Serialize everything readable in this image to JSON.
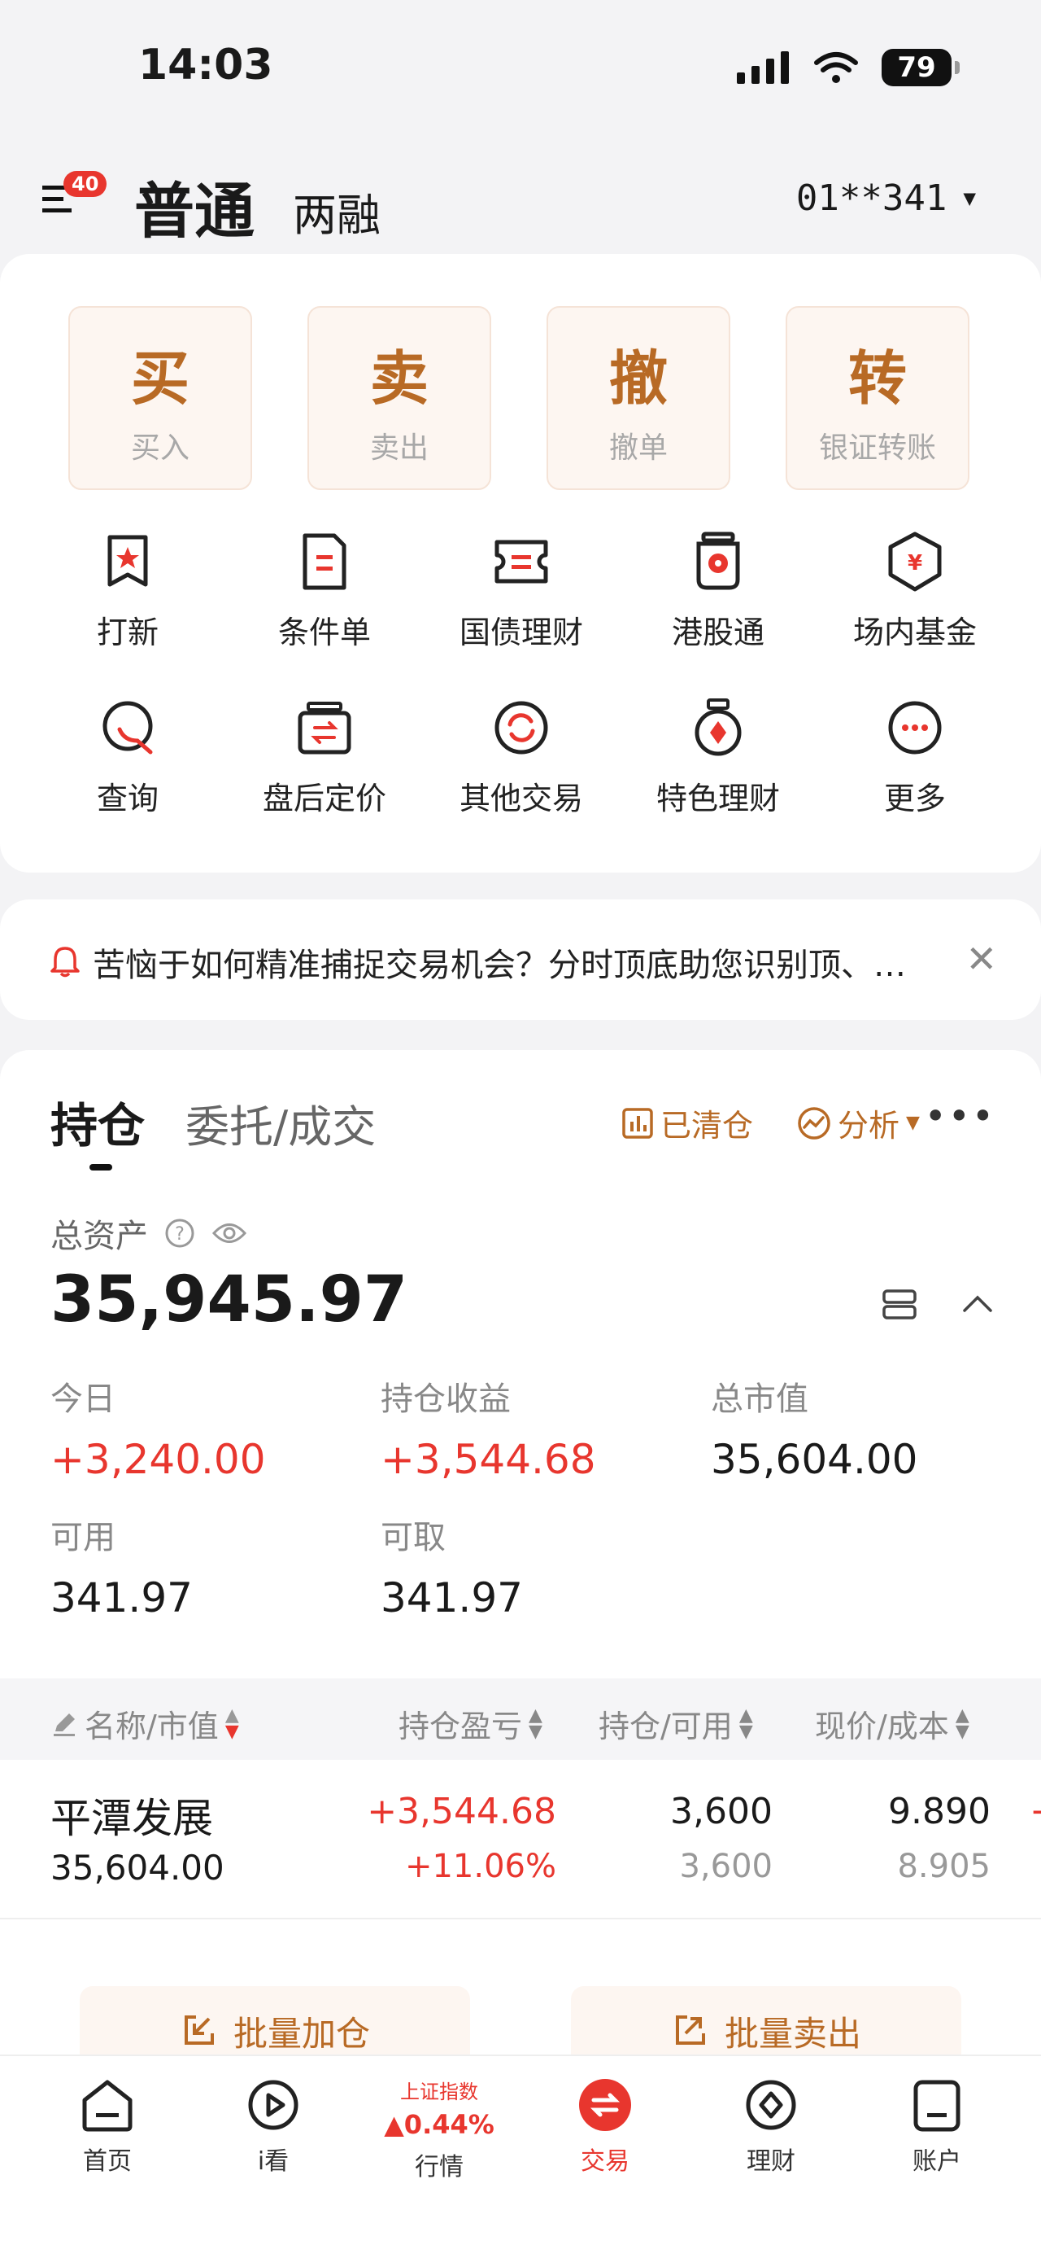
{
  "status_bar": {
    "time": "14:03",
    "battery": "79"
  },
  "header": {
    "menu_badge": "40",
    "account_type": "普通",
    "account_margin": "两融",
    "account_number": "01**341"
  },
  "actions": [
    {
      "glyph": "买",
      "label": "买入"
    },
    {
      "glyph": "卖",
      "label": "卖出"
    },
    {
      "glyph": "撤",
      "label": "撤单"
    },
    {
      "glyph": "转",
      "label": "银证转账"
    }
  ],
  "grid": [
    {
      "label": "打新",
      "icon": "ipo-icon"
    },
    {
      "label": "条件单",
      "icon": "conditional-order-icon"
    },
    {
      "label": "国债理财",
      "icon": "bond-icon"
    },
    {
      "label": "港股通",
      "icon": "hk-connect-icon"
    },
    {
      "label": "场内基金",
      "icon": "fund-icon"
    },
    {
      "label": "查询",
      "icon": "query-icon"
    },
    {
      "label": "盘后定价",
      "icon": "after-hours-icon"
    },
    {
      "label": "其他交易",
      "icon": "other-trade-icon"
    },
    {
      "label": "特色理财",
      "icon": "featured-wealth-icon"
    },
    {
      "label": "更多",
      "icon": "more-icon"
    }
  ],
  "notice": {
    "text": "苦恼于如何精准捕捉交易机会？分时顶底助您识别顶、…"
  },
  "holdings": {
    "tab_positions": "持仓",
    "tab_orders": "委托/成交",
    "cleared_label": "已清仓",
    "analysis_label": "分析",
    "total_assets_label": "总资产",
    "total_assets_value": "35,945.97",
    "today_label": "今日",
    "today_value": "+3,240.00",
    "position_pnl_label": "持仓收益",
    "position_pnl_value": "+3,544.68",
    "market_value_label": "总市值",
    "market_value_value": "35,604.00",
    "available_label": "可用",
    "available_value": "341.97",
    "withdrawable_label": "可取",
    "withdrawable_value": "341.97",
    "columns": [
      "名称/市值",
      "持仓盈亏",
      "持仓/可用",
      "现价/成本"
    ],
    "rows": [
      {
        "name": "平潭发展",
        "market_value": "35,604.00",
        "pnl": "+3,544.68",
        "pnl_pct": "+11.06%",
        "position": "3,600",
        "available": "3,600",
        "price": "9.890",
        "cost": "8.905"
      }
    ],
    "bulk_add_label": "批量加仓",
    "bulk_sell_label": "批量卖出"
  },
  "bottom_nav": {
    "home": "首页",
    "watch": "i看",
    "index_name": "上证指数",
    "index_change": "▲0.44%",
    "market": "行情",
    "trade": "交易",
    "wealth": "理财",
    "account": "账户"
  },
  "colors": {
    "accent": "#e8362e",
    "brown": "#b86a25"
  }
}
